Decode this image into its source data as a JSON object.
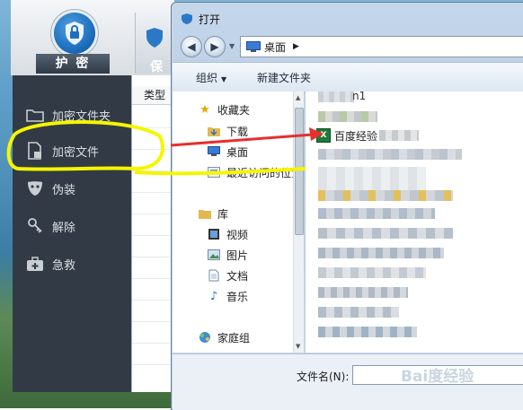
{
  "app": {
    "title": "护 密",
    "second_tab_label": "保",
    "nav": [
      {
        "label": "加密文件夹",
        "icon": "folder-icon"
      },
      {
        "label": "加密文件",
        "icon": "document-lock-icon"
      },
      {
        "label": "伪装",
        "icon": "mask-icon"
      },
      {
        "label": "解除",
        "icon": "key-icon"
      },
      {
        "label": "急救",
        "icon": "first-aid-icon"
      }
    ],
    "column_header": "类型"
  },
  "dialog": {
    "title": "打开",
    "address": "桌面",
    "commands": {
      "organize": "组织",
      "new_folder": "新建文件夹"
    },
    "nav_pane": {
      "favorites_label": "收藏夹",
      "favorites": [
        "下载",
        "桌面",
        "最近访问的位置"
      ],
      "library_label": "库",
      "library": [
        "视频",
        "图片",
        "文档",
        "音乐"
      ],
      "homegroup_label": "家庭组"
    },
    "files": {
      "first_fragment": "n1",
      "highlighted_file": "百度经验"
    },
    "filename_label": "文件名(N):",
    "filename_value": ""
  },
  "watermark": "Bai度经验",
  "colors": {
    "sidebar_bg": "#323b45",
    "dialog_frame": "#b8cce3",
    "highlight_circle": "#f5f500",
    "arrow": "#e53030"
  }
}
